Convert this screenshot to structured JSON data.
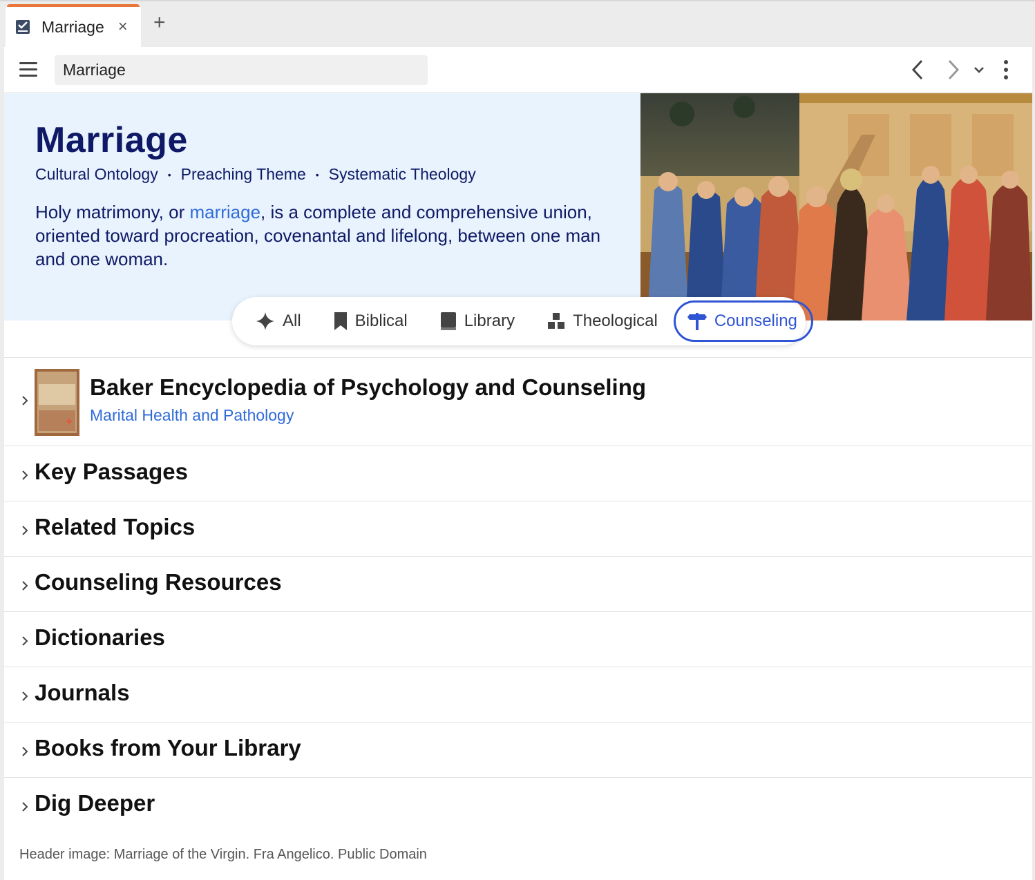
{
  "tab": {
    "title": "Marriage",
    "close": "×",
    "add": "+"
  },
  "toolbar": {
    "address_value": "Marriage"
  },
  "hero": {
    "title": "Marriage",
    "tags": [
      "Cultural Ontology",
      "Preaching Theme",
      "Systematic Theology"
    ],
    "tag_separator": "•",
    "desc_before": "Holy matrimony, or ",
    "desc_link": "marriage",
    "desc_after": ", is a complete and comprehensive union, oriented toward procreation, covenantal and lifelong, between one man and one woman."
  },
  "filters": [
    {
      "label": "All",
      "icon": "sparkle-icon"
    },
    {
      "label": "Biblical",
      "icon": "bookmark-icon"
    },
    {
      "label": "Library",
      "icon": "book-icon"
    },
    {
      "label": "Theological",
      "icon": "blocks-icon"
    },
    {
      "label": "Counseling",
      "icon": "signpost-icon",
      "active": true
    }
  ],
  "featured": {
    "title": "Baker Encyclopedia of Psychology and Counseling",
    "subtitle": "Marital Health and Pathology",
    "cover_text": "BAKER ENCYCLOPEDIA of PSYCHOLOGY & COUNSELING"
  },
  "sections": [
    "Key Passages",
    "Related Topics",
    "Counseling Resources",
    "Dictionaries",
    "Journals",
    "Books from Your Library",
    "Dig Deeper"
  ],
  "footer": "Header image: Marriage of the Virgin. Fra Angelico. Public Domain",
  "colors": {
    "accent": "#e8773a",
    "title": "#0f1966",
    "link": "#2f6bd8",
    "active": "#2f55d4",
    "hero_bg": "#e8f3fd"
  }
}
